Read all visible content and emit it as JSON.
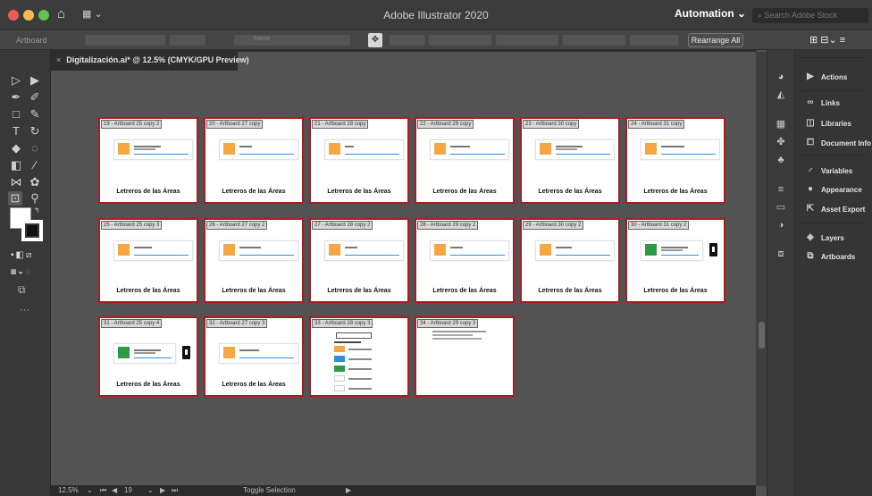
{
  "window": {
    "title": "Adobe Illustrator 2020",
    "workspace": "Automation",
    "search_placeholder": "Search Adobe Stock"
  },
  "control_bar": {
    "context_label": "Artboard",
    "name_label": "Name",
    "rearrange_label": "Rearrange All"
  },
  "document": {
    "tab_title": "Digitalización.ai* @ 12.5% (CMYK/GPU Preview)",
    "close": "×"
  },
  "colors": {
    "artboard_border": "#a71e22",
    "orange": "#f6a745",
    "blue": "#2f90d9",
    "green": "#2f9a44"
  },
  "artboards": [
    {
      "label": "19 - Artboard 25 copy 2",
      "footer": "Letreros de las Áreas"
    },
    {
      "label": "20 - Artboard 27 copy",
      "footer": "Letreros de las Áreas"
    },
    {
      "label": "21 - Artboard 28 copy",
      "footer": "Letreros de las Áreas"
    },
    {
      "label": "22 - Artboard 29 copy",
      "footer": "Letreros de las Áreas"
    },
    {
      "label": "23 - Artboard 30 copy",
      "footer": "Letreros de las Áreas"
    },
    {
      "label": "24 - Artboard 31 copy",
      "footer": "Letreros de las Áreas"
    },
    {
      "label": "25 - Artboard 25 copy 3",
      "footer": "Letreros de las Áreas"
    },
    {
      "label": "26 - Artboard 27 copy 2",
      "footer": "Letreros de las Áreas"
    },
    {
      "label": "27 - Artboard 28 copy 2",
      "footer": "Letreros de las Áreas"
    },
    {
      "label": "28 - Artboard 29 copy 2",
      "footer": "Letreros de las Áreas"
    },
    {
      "label": "29 - Artboard 30 copy 2",
      "footer": "Letreros de las Áreas"
    },
    {
      "label": "30 - Artboard 31 copy 2",
      "footer": "Letreros de las Áreas"
    },
    {
      "label": "31 - Artboard 25 copy 4",
      "footer": "Letreros de las Áreas"
    },
    {
      "label": "32 - Artboard 27 copy 3",
      "footer": "Letreros de las Áreas"
    },
    {
      "label": "33 - Artboard 28 copy 3",
      "footer": ""
    },
    {
      "label": "34 - Artboard 29 copy 3",
      "footer": ""
    }
  ],
  "panels": [
    {
      "label": "Actions",
      "icon": "play-icon"
    },
    {
      "label": "Links",
      "icon": "link-icon"
    },
    {
      "label": "Libraries",
      "icon": "libraries-icon"
    },
    {
      "label": "Document Info",
      "icon": "document-info-icon"
    },
    {
      "label": "Variables",
      "icon": "variables-icon"
    },
    {
      "label": "Appearance",
      "icon": "appearance-icon"
    },
    {
      "label": "Asset Export",
      "icon": "asset-export-icon"
    },
    {
      "label": "Layers",
      "icon": "layers-icon"
    },
    {
      "label": "Artboards",
      "icon": "artboards-icon"
    }
  ],
  "status": {
    "zoom": "12.5%",
    "artboard_number": "19",
    "mode": "Toggle Selection"
  }
}
